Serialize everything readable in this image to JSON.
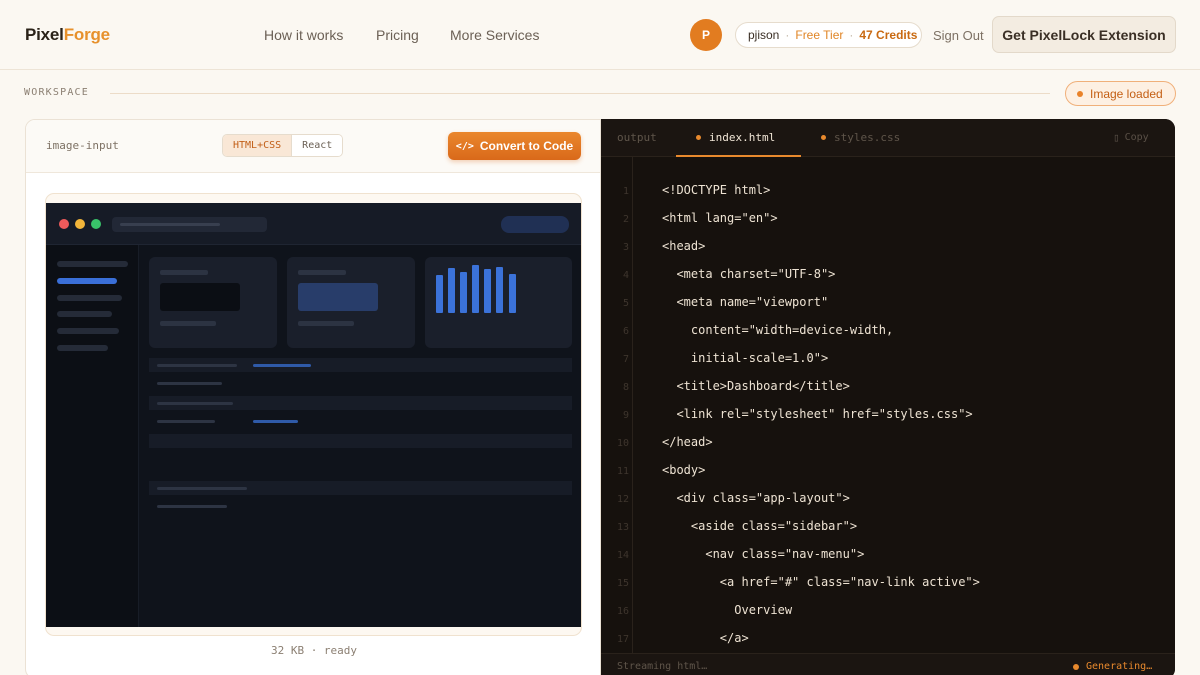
{
  "header": {
    "logo_part1": "Pixel",
    "logo_part2": "Forge",
    "nav": [
      "How it works",
      "Pricing",
      "More Services"
    ],
    "avatar_initial": "P",
    "username": "pjison",
    "tier": "Free Tier",
    "credits": "47 Credits",
    "sign_out": "Sign Out",
    "extension_button": "Get PixelLock Extension"
  },
  "workspace": {
    "label": "WORKSPACE",
    "status_badge": "Image loaded"
  },
  "input_panel": {
    "title": "image-input",
    "formats": [
      "HTML+CSS",
      "React"
    ],
    "selected_format": "HTML+CSS",
    "convert_button": "Convert to Code",
    "file_meta": "32 KB · ready"
  },
  "code_panel": {
    "tabs": [
      "output",
      "index.html",
      "styles.css"
    ],
    "active_tab": "index.html",
    "copy_label": "Copy",
    "lines": [
      "<!DOCTYPE html>",
      "<html lang=\"en\">",
      "<head>",
      "  <meta charset=\"UTF-8\">",
      "  <meta name=\"viewport\"",
      "    content=\"width=device-width,",
      "    initial-scale=1.0\">",
      "  <title>Dashboard</title>",
      "  <link rel=\"stylesheet\" href=\"styles.css\">",
      "</head>",
      "<body>",
      "  <div class=\"app-layout\">",
      "    <aside class=\"sidebar\">",
      "      <nav class=\"nav-menu\">",
      "        <a href=\"#\" class=\"nav-link active\">",
      "          Overview",
      "        </a>"
    ],
    "status_left": "Streaming html…",
    "status_right": "Generating…"
  },
  "colors": {
    "accent": "#e8892d",
    "background": "#fbf8f2",
    "code_background": "#16110d"
  }
}
